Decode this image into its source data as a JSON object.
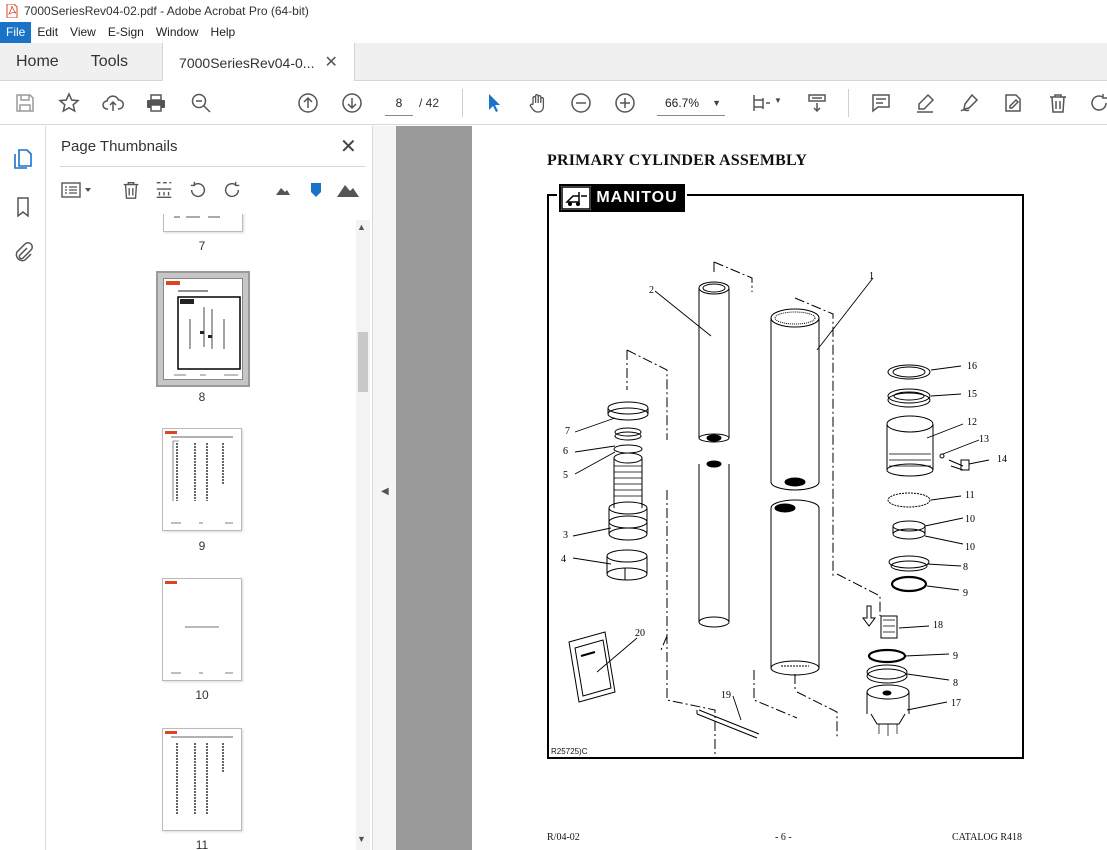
{
  "window": {
    "title": "7000SeriesRev04-02.pdf - Adobe Acrobat Pro (64-bit)"
  },
  "menu": [
    "File",
    "Edit",
    "View",
    "E-Sign",
    "Window",
    "Help"
  ],
  "tabs": {
    "home": "Home",
    "tools": "Tools",
    "document": "7000SeriesRev04-0..."
  },
  "toolbar": {
    "page_current": "8",
    "page_total": "/ 42",
    "zoom": "66.7%"
  },
  "thumbnails": {
    "title": "Page Thumbnails",
    "pages": [
      "7",
      "8",
      "9",
      "10",
      "11"
    ],
    "selected": "8"
  },
  "document": {
    "heading": "PRIMARY CYLINDER ASSEMBLY",
    "logo_text": "MANITOU",
    "figure_ref": "R25725)C",
    "footer_left": "R/04-02",
    "footer_center": "- 6 -",
    "footer_right": "CATALOG R418",
    "callouts": [
      "1",
      "2",
      "3",
      "4",
      "5",
      "6",
      "7",
      "8",
      "8",
      "9",
      "9",
      "10",
      "10",
      "11",
      "12",
      "13",
      "14",
      "15",
      "16",
      "17",
      "18",
      "19",
      "20"
    ]
  },
  "colors": {
    "accent": "#1a73c7",
    "doc_bg": "#9a9a9a"
  }
}
